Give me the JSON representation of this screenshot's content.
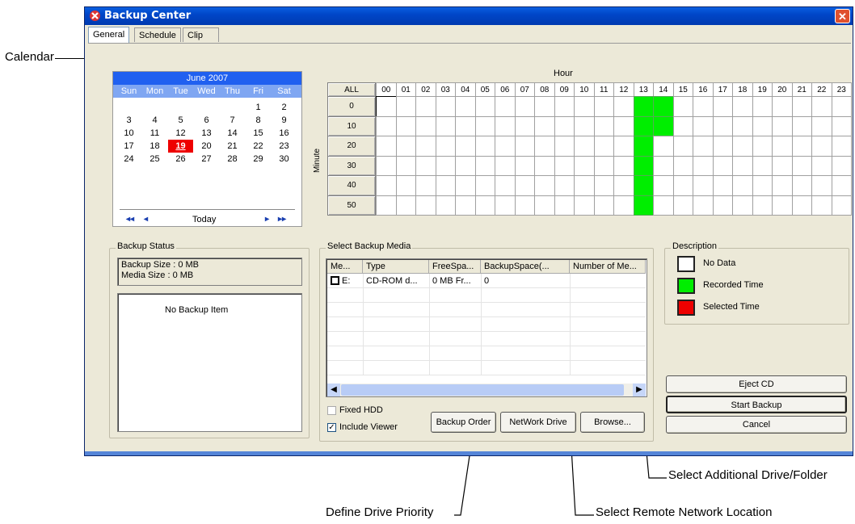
{
  "window": {
    "title": "Backup Center",
    "close_glyph": "✕"
  },
  "tabs": [
    {
      "label": "General"
    },
    {
      "label": "Schedule"
    },
    {
      "label": "Clip"
    }
  ],
  "calendar": {
    "month_label": "June 2007",
    "weekdays": [
      "Sun",
      "Mon",
      "Tue",
      "Wed",
      "Thu",
      "Fri",
      "Sat"
    ],
    "weeks": [
      [
        "",
        "",
        "",
        "",
        "",
        "1",
        "2"
      ],
      [
        "3",
        "4",
        "5",
        "6",
        "7",
        "8",
        "9"
      ],
      [
        "10",
        "11",
        "12",
        "13",
        "14",
        "15",
        "16"
      ],
      [
        "17",
        "18",
        "19",
        "20",
        "21",
        "22",
        "23"
      ],
      [
        "24",
        "25",
        "26",
        "27",
        "28",
        "29",
        "30"
      ]
    ],
    "selected_day": "19",
    "today_label": "Today",
    "nav_prev_year": "◂◂",
    "nav_prev_month": "◂",
    "nav_next_month": "▸",
    "nav_next_year": "▸▸"
  },
  "grid": {
    "hour_label": "Hour",
    "minute_label": "Minute",
    "all_label": "ALL",
    "hours": [
      "00",
      "01",
      "02",
      "03",
      "04",
      "05",
      "06",
      "07",
      "08",
      "09",
      "10",
      "11",
      "12",
      "13",
      "14",
      "15",
      "16",
      "17",
      "18",
      "19",
      "20",
      "21",
      "22",
      "23"
    ],
    "minutes": [
      "0",
      "10",
      "20",
      "30",
      "40",
      "50"
    ],
    "recorded": [
      [
        13,
        0
      ],
      [
        13,
        1
      ],
      [
        13,
        2
      ],
      [
        13,
        3
      ],
      [
        13,
        4
      ],
      [
        13,
        5
      ],
      [
        14,
        0
      ],
      [
        14,
        1
      ]
    ],
    "selected_outline": [
      0,
      0
    ],
    "recorded_color": "#00ee00"
  },
  "backup_status": {
    "title": "Backup Status",
    "backup_size": "Backup Size : 0 MB",
    "media_size": "Media Size : 0 MB",
    "empty_text": "No Backup Item"
  },
  "media": {
    "title": "Select Backup Media",
    "columns": [
      "Me...",
      "Type",
      "FreeSpa...",
      "BackupSpace(...",
      "Number of Me..."
    ],
    "rows": [
      [
        "E:",
        "CD-ROM d...",
        "0 MB Fr...",
        "0",
        ""
      ]
    ],
    "fixed_hdd_label": "Fixed HDD",
    "fixed_hdd_checked": false,
    "include_viewer_label": "Include Viewer",
    "include_viewer_checked": true,
    "backup_order_label": "Backup Order",
    "network_drive_label": "NetWork Drive",
    "browse_label": "Browse..."
  },
  "description": {
    "title": "Description",
    "items": [
      {
        "label": "No Data",
        "color": "#ffffff"
      },
      {
        "label": "Recorded Time",
        "color": "#00ee00"
      },
      {
        "label": "Selected Time",
        "color": "#ee0000"
      }
    ]
  },
  "actions": {
    "eject_label": "Eject CD",
    "start_label": "Start Backup",
    "cancel_label": "Cancel"
  },
  "annotations": {
    "calendar": "Calendar",
    "define_priority": "Define Drive Priority",
    "remote_location": "Select Remote Network Location",
    "additional_drive": "Select Additional Drive/Folder"
  }
}
